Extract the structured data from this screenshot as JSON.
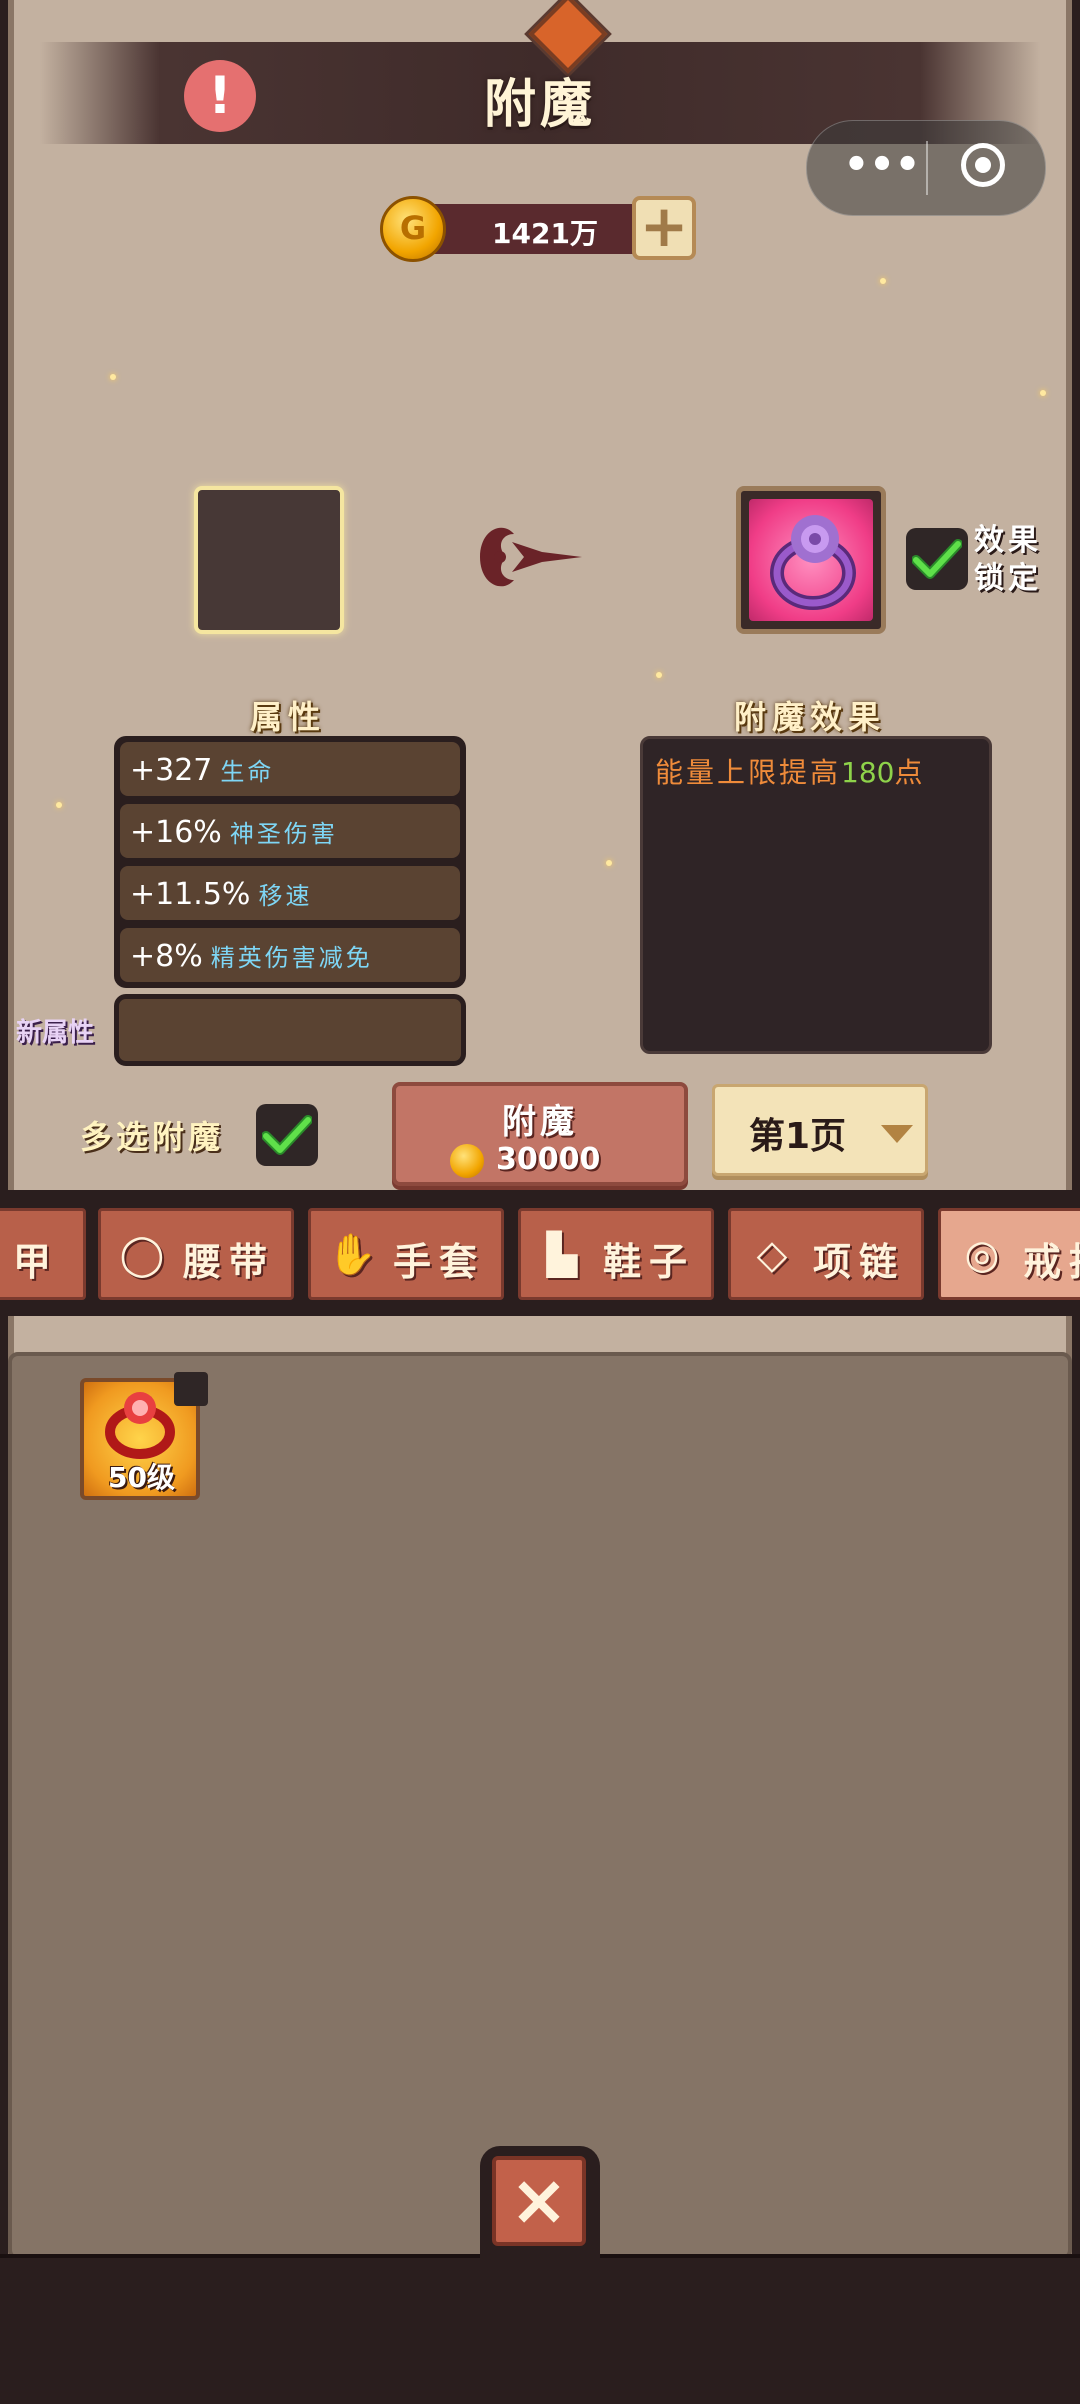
{
  "header": {
    "title": "附魔",
    "alert_icon": "!"
  },
  "mini_program_capsule": {
    "more_icon": "•••"
  },
  "currency": {
    "amount": "1421万",
    "add_icon": "+"
  },
  "enchant": {
    "lock_label": "效果锁定",
    "attributes_title": "属性",
    "attributes": [
      {
        "value": "+327",
        "name": "生命"
      },
      {
        "value": "+16%",
        "name": "神圣伤害"
      },
      {
        "value": "+11.5%",
        "name": "移速"
      },
      {
        "value": "+8%",
        "name": "精英伤害减免"
      }
    ],
    "new_attribute_label": "新属性",
    "effect_title": "附魔效果",
    "effect": {
      "prefix": "能量上限提高",
      "number": "180",
      "suffix": "点"
    },
    "multi_select_label": "多选附魔",
    "enchant_button": {
      "label": "附魔",
      "cost": "30000"
    },
    "page_selector": {
      "label": "第1页"
    }
  },
  "tabs": [
    {
      "label": "甲",
      "icon": "armor-icon"
    },
    {
      "label": "腰带",
      "icon": "belt-icon"
    },
    {
      "label": "手套",
      "icon": "glove-icon"
    },
    {
      "label": "鞋子",
      "icon": "boot-icon"
    },
    {
      "label": "项链",
      "icon": "necklace-icon"
    },
    {
      "label": "戒指",
      "icon": "ring-icon"
    }
  ],
  "inventory": [
    {
      "level": "50级",
      "icon": "ring-icon"
    }
  ],
  "close_icon": "×",
  "colors": {
    "accent_green": "#8ed24a",
    "effect_orange": "#ef8b3a",
    "attr_blue": "#7ed6f5"
  }
}
